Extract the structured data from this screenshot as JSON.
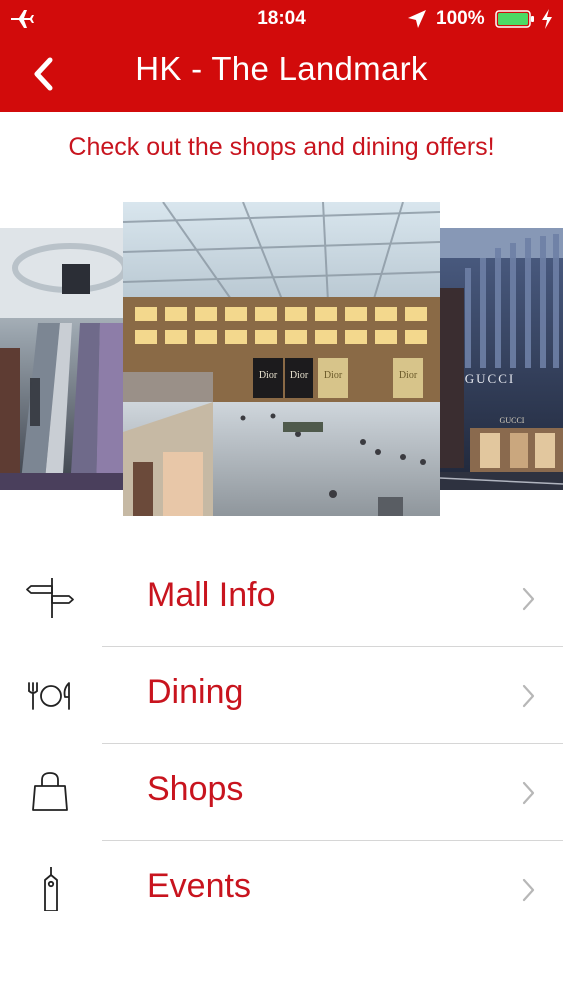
{
  "status_bar": {
    "time": "18:04",
    "battery_percent": "100%",
    "battery_level": 1.0,
    "icons": [
      "airplane-icon",
      "location-arrow-icon",
      "battery-icon",
      "charging-bolt-icon"
    ]
  },
  "header": {
    "title": "HK - The Landmark",
    "back_icon": "chevron-left-icon"
  },
  "tagline": "Check out the shops and dining offers!",
  "carousel": {
    "slides": [
      {
        "name": "escalator-photo"
      },
      {
        "name": "atrium-photo",
        "signs": [
          "Dior",
          "Dior",
          "Dior",
          "Dior"
        ]
      },
      {
        "name": "storefront-photo",
        "signs": [
          "GUCCI",
          "GUCCI"
        ]
      }
    ]
  },
  "menu": {
    "items": [
      {
        "label": "Mall Info",
        "icon": "signpost-icon"
      },
      {
        "label": "Dining",
        "icon": "cutlery-icon"
      },
      {
        "label": "Shops",
        "icon": "shopping-bag-icon"
      },
      {
        "label": "Events",
        "icon": "tag-icon"
      }
    ]
  },
  "colors": {
    "brand_red": "#d20b0b",
    "text_red": "#c8141e",
    "separator": "#d6d6d6",
    "battery_green": "#4cd964"
  }
}
